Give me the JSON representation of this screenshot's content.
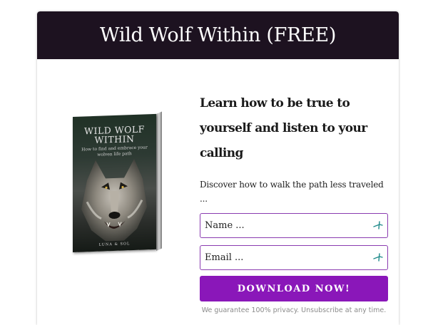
{
  "header": {
    "title": "Wild Wolf Within (FREE)"
  },
  "book": {
    "title_line1": "WILD WOLF",
    "title_line2": "WITHIN",
    "subtitle": "How to find and embrace your wolven life path",
    "author": "LUNA & SOL",
    "image": "wolf-cover-image"
  },
  "content": {
    "headline": "Learn how to be true to yourself and listen to your calling",
    "description": "Discover how to walk the path less traveled ...",
    "name_placeholder": "Name ...",
    "email_placeholder": "Email ...",
    "field_icon": "autofill-key-icon",
    "button_label": "DOWNLOAD NOW!",
    "privacy": "We guarantee 100% privacy. Unsubscribe at any time."
  },
  "colors": {
    "header_bg": "#1d1220",
    "accent": "#8a17b9",
    "field_border": "#8a3bb0"
  }
}
